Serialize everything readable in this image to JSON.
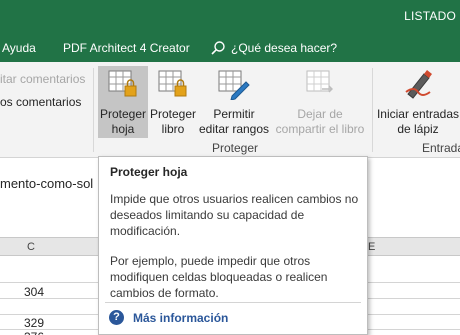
{
  "window": {
    "title": "LISTADO"
  },
  "tabs": [
    {
      "label": "Ayuda"
    },
    {
      "label": "PDF Architect 4 Creator"
    }
  ],
  "search": {
    "label": "¿Qué desea hacer?"
  },
  "ribbon": {
    "left_items": [
      {
        "label": "itar comentarios"
      },
      {
        "label": "os comentarios"
      }
    ],
    "buttons": {
      "protect_sheet": {
        "line1": "Proteger",
        "line2": "hoja"
      },
      "protect_book": {
        "line1": "Proteger",
        "line2": "libro"
      },
      "allow_ranges": {
        "line1": "Permitir",
        "line2": "editar rangos"
      },
      "unshare": {
        "line1": "Dejar de",
        "line2": "compartir el libro"
      },
      "ink": {
        "line1": "Iniciar entradas",
        "line2": "de lápiz"
      }
    },
    "groups": {
      "protect": "Proteger",
      "ink": "Entrada"
    }
  },
  "sheet": {
    "formula_text": "mento-como-sol",
    "column_headers": [
      "C",
      "E"
    ],
    "cells": [
      "304",
      "329",
      "376"
    ]
  },
  "tooltip": {
    "title": "Proteger hoja",
    "paragraph1": "Impide que otros usuarios realicen cambios no deseados limitando su capacidad de modificación.",
    "paragraph2": "Por ejemplo, puede impedir que otros modifiquen celdas bloqueadas o realicen cambios de formato.",
    "more_info": "Más información"
  },
  "colors": {
    "accent": "#217346",
    "link": "#2b579a"
  }
}
